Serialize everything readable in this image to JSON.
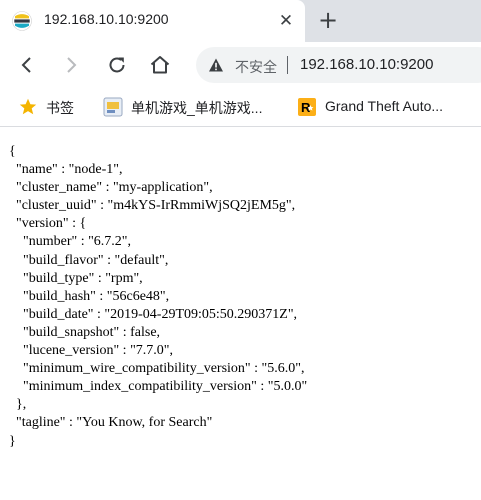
{
  "tab": {
    "title": "192.168.10.10:9200",
    "close_glyph": "✕",
    "favicon": "elastic-icon"
  },
  "new_tab_glyph": "+",
  "toolbar": {
    "back_icon": "arrow-left-icon",
    "forward_icon": "arrow-right-icon",
    "reload_icon": "reload-icon",
    "home_icon": "home-icon"
  },
  "omnibox": {
    "security_text": "不安全",
    "url": "192.168.10.10:9200",
    "warning_icon": "warning-icon"
  },
  "bookmarks": [
    {
      "label": "书签",
      "icon": "star-icon"
    },
    {
      "label": "单机游戏_单机游戏...",
      "icon": "game-site-icon"
    },
    {
      "label": "Grand Theft Auto...",
      "icon": "rockstar-icon"
    }
  ],
  "json_lines": [
    "{",
    "  \"name\" : \"node-1\",",
    "  \"cluster_name\" : \"my-application\",",
    "  \"cluster_uuid\" : \"m4kYS-IrRmmiWjSQ2jEM5g\",",
    "  \"version\" : {",
    "    \"number\" : \"6.7.2\",",
    "    \"build_flavor\" : \"default\",",
    "    \"build_type\" : \"rpm\",",
    "    \"build_hash\" : \"56c6e48\",",
    "    \"build_date\" : \"2019-04-29T09:05:50.290371Z\",",
    "    \"build_snapshot\" : false,",
    "    \"lucene_version\" : \"7.7.0\",",
    "    \"minimum_wire_compatibility_version\" : \"5.6.0\",",
    "    \"minimum_index_compatibility_version\" : \"5.0.0\"",
    "  },",
    "  \"tagline\" : \"You Know, for Search\"",
    "}"
  ]
}
